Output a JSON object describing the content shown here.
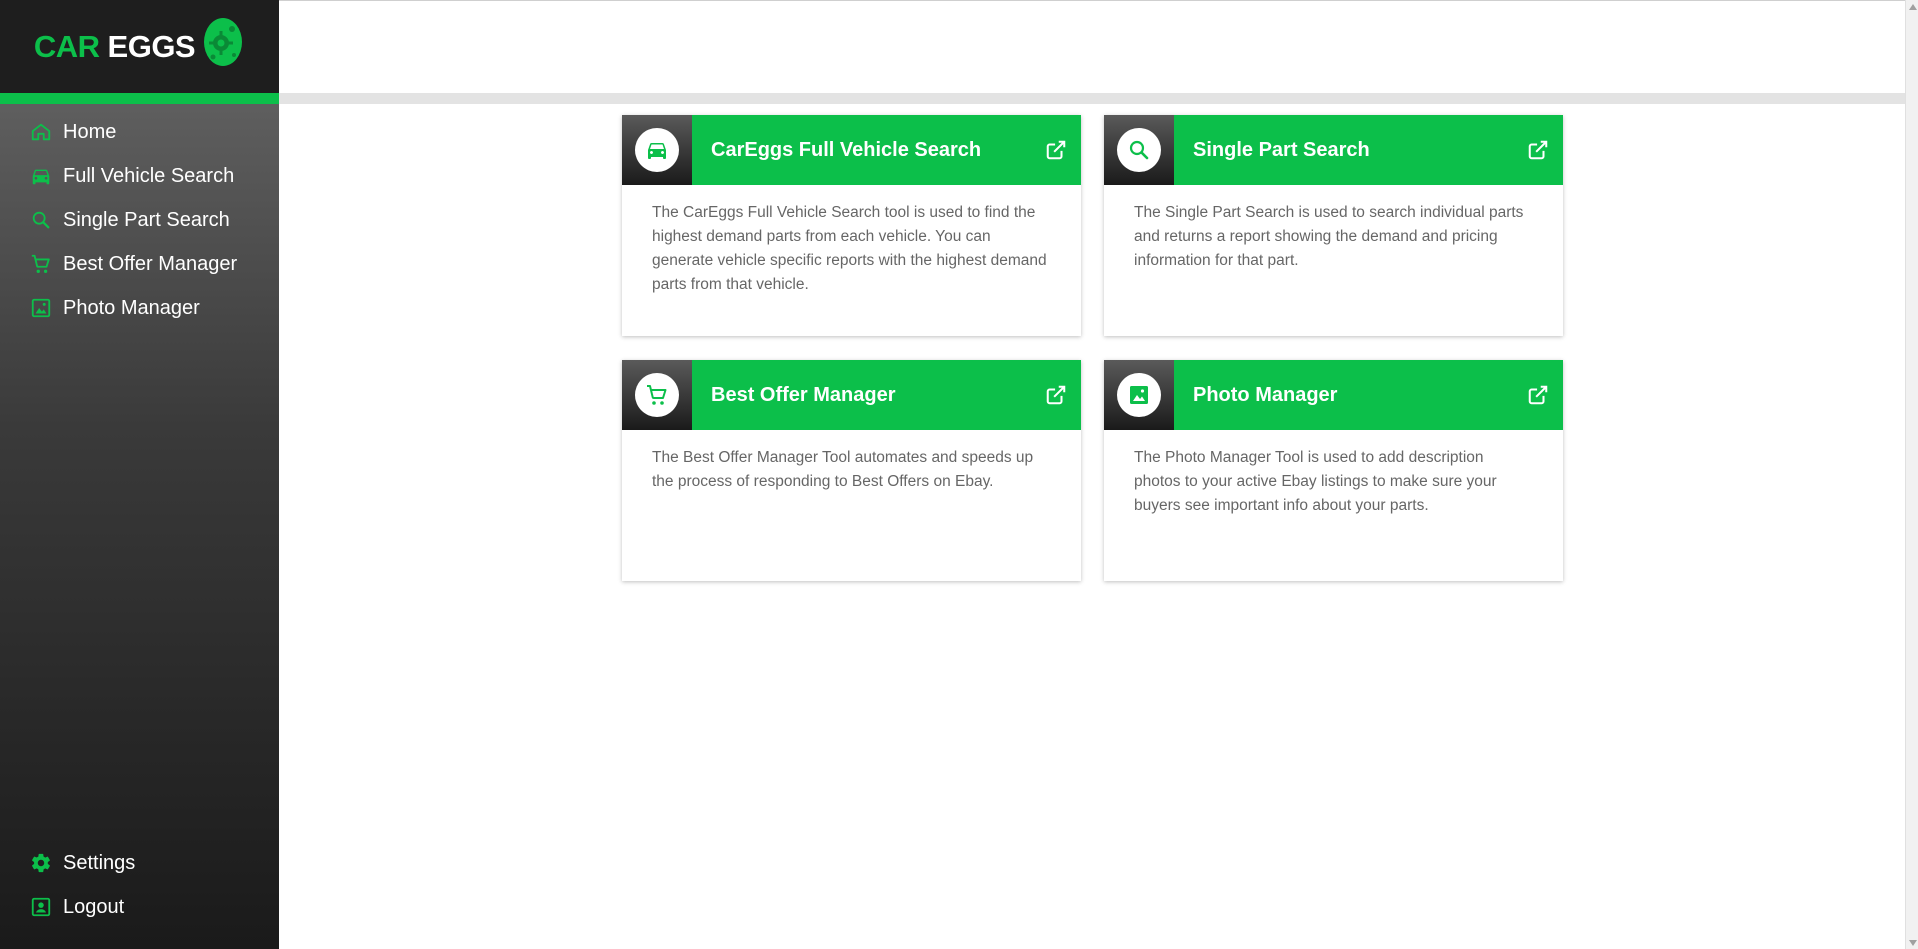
{
  "brand": {
    "name_part1": "CAR",
    "name_part2": "EGGS",
    "green": "#0cbf4a"
  },
  "sidebar": {
    "items": [
      {
        "label": "Home",
        "icon": "home-icon"
      },
      {
        "label": "Full Vehicle Search",
        "icon": "car-icon"
      },
      {
        "label": "Single Part Search",
        "icon": "search-icon"
      },
      {
        "label": "Best Offer Manager",
        "icon": "cart-icon"
      },
      {
        "label": "Photo Manager",
        "icon": "image-icon"
      }
    ],
    "bottom_items": [
      {
        "label": "Settings",
        "icon": "gear-icon"
      },
      {
        "label": "Logout",
        "icon": "account-box-icon"
      }
    ]
  },
  "cards": [
    {
      "title": "CarEggs Full Vehicle Search",
      "icon": "car-icon",
      "description": "The CarEggs Full Vehicle Search tool is used to find the highest demand parts from each vehicle. You can generate vehicle specific reports with the highest demand parts from that vehicle."
    },
    {
      "title": "Single Part Search",
      "icon": "search-icon",
      "description": "The Single Part Search is used to search individual parts and returns a report showing the demand and pricing information for that part."
    },
    {
      "title": "Best Offer Manager",
      "icon": "cart-icon",
      "description": "The Best Offer Manager Tool automates and speeds up the process of responding to Best Offers on Ebay."
    },
    {
      "title": "Photo Manager",
      "icon": "image-icon",
      "description": "The Photo Manager Tool is used to add description photos to your active Ebay listings to make sure your buyers see important info about your parts."
    }
  ]
}
